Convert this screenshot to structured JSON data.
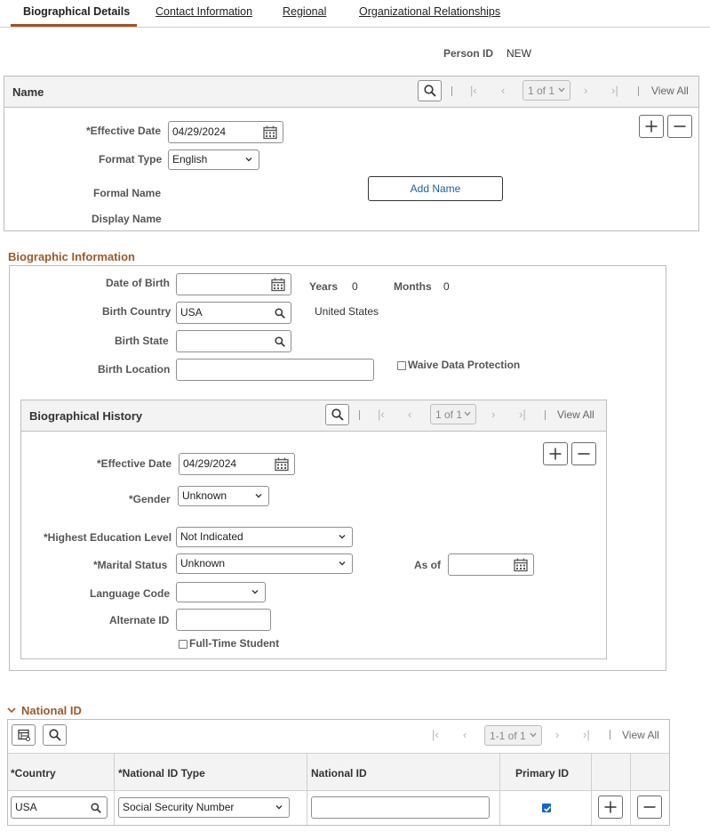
{
  "tabs": [
    "Biographical Details",
    "Contact Information",
    "Regional",
    "Organizational Relationships"
  ],
  "person": {
    "label": "Person ID",
    "value": "NEW"
  },
  "name_box": {
    "title": "Name",
    "pager": "1 of 1",
    "view_all": "View All",
    "effective_date_label": "*Effective Date",
    "effective_date": "04/29/2024",
    "format_type_label": "Format Type",
    "format_type": "English",
    "formal_name_label": "Formal Name",
    "display_name_label": "Display Name",
    "add_name": "Add Name"
  },
  "bio": {
    "title": "Biographic Information",
    "dob_label": "Date of Birth",
    "years_label": "Years",
    "years": "0",
    "months_label": "Months",
    "months": "0",
    "birth_country_label": "Birth Country",
    "birth_country": "USA",
    "birth_country_desc": "United States",
    "birth_state_label": "Birth State",
    "birth_location_label": "Birth Location",
    "waive_label": "Waive Data Protection"
  },
  "history": {
    "title": "Biographical History",
    "pager": "1 of 1",
    "view_all": "View All",
    "effective_date_label": "*Effective Date",
    "effective_date": "04/29/2024",
    "gender_label": "*Gender",
    "gender": "Unknown",
    "education_label": "*Highest Education Level",
    "education": "Not Indicated",
    "marital_label": "*Marital Status",
    "marital": "Unknown",
    "as_of_label": "As of",
    "language_label": "Language Code",
    "alternate_label": "Alternate ID",
    "fulltime_label": "Full-Time Student"
  },
  "national": {
    "title": "National ID",
    "pager": "1-1 of 1",
    "view_all": "View All",
    "headers": [
      "*Country",
      "*National ID Type",
      "National ID",
      "Primary ID"
    ],
    "row": {
      "country": "USA",
      "type": "Social Security Number",
      "id": ""
    }
  },
  "colors": {
    "accent": "#9b5a2b",
    "link": "#1d5fa8",
    "checkbox": "#1565c0"
  }
}
